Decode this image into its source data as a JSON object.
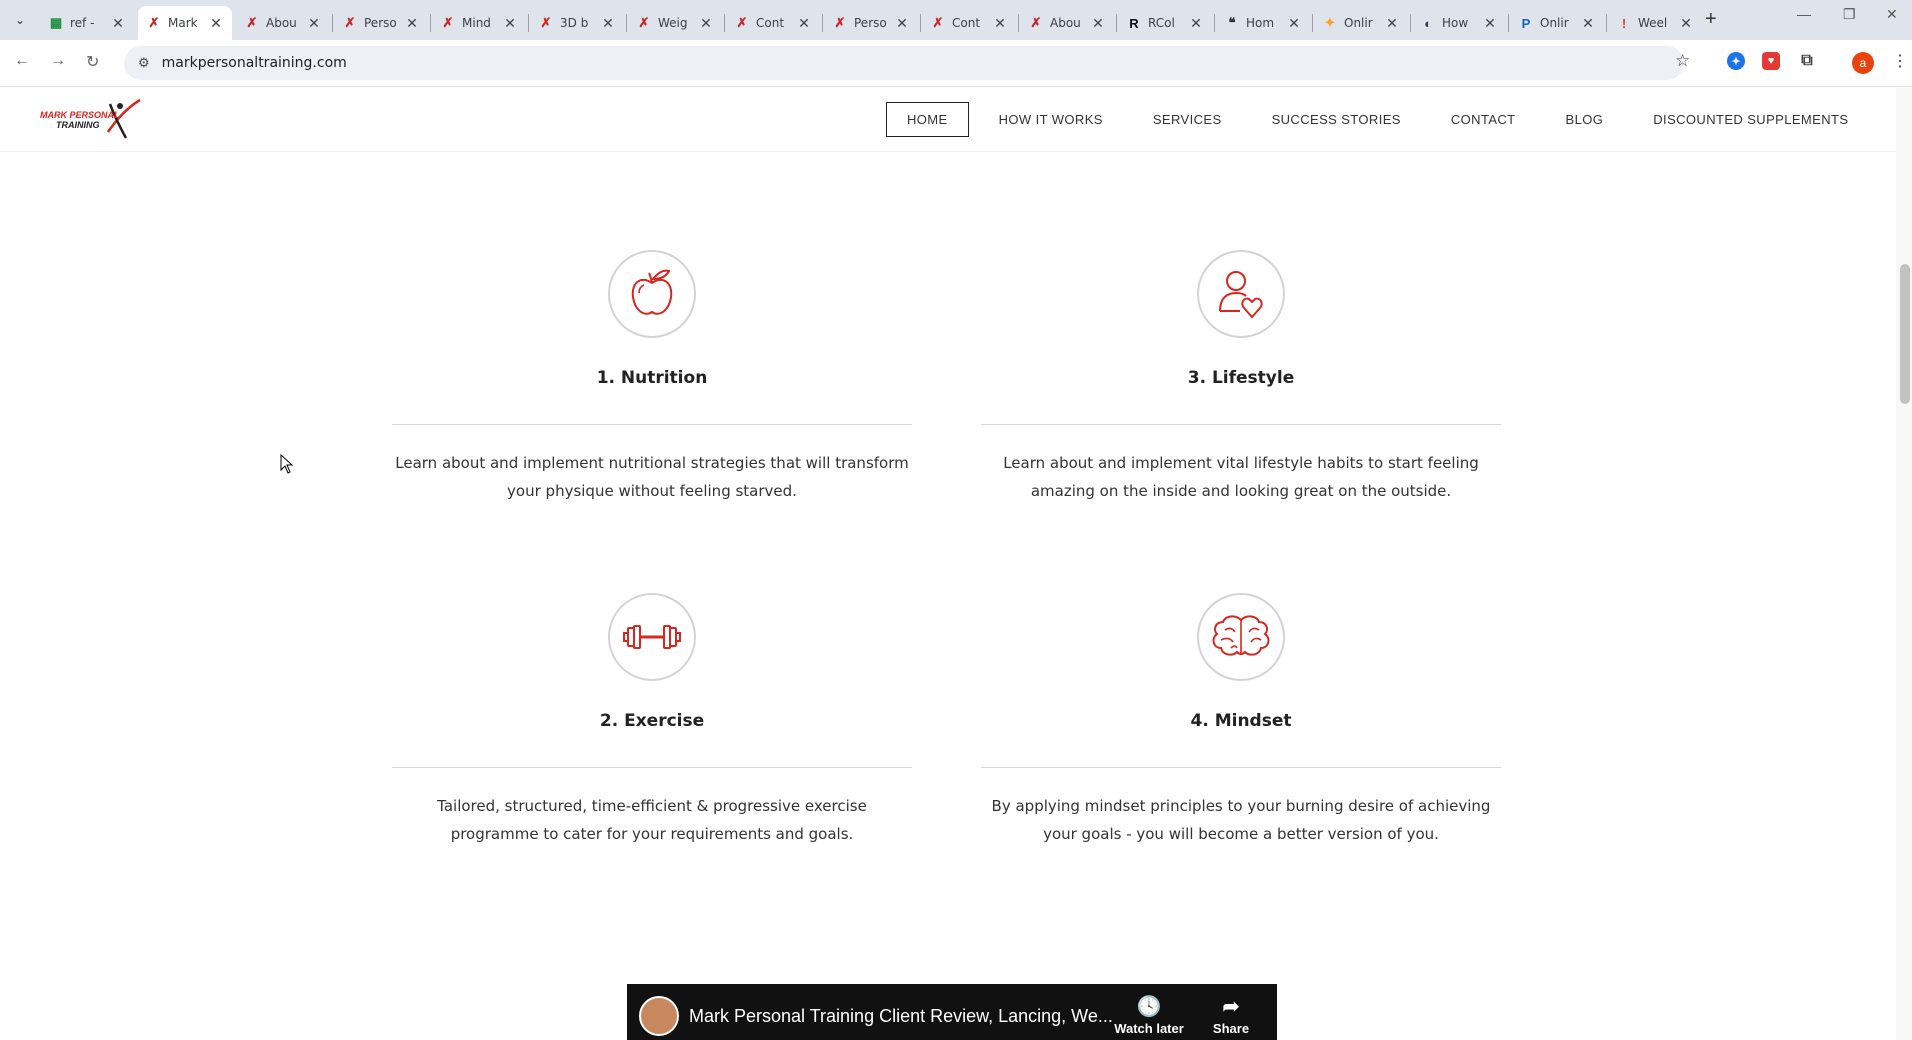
{
  "browser": {
    "tabs": [
      {
        "title": "ref -",
        "favicon": "sheets-icon",
        "color": "#1e8e3e",
        "active": false
      },
      {
        "title": "Mark",
        "favicon": "mpt-icon",
        "color": "#c62828",
        "active": true
      },
      {
        "title": "Abou",
        "favicon": "mpt-icon",
        "color": "#c62828",
        "active": false
      },
      {
        "title": "Perso",
        "favicon": "mpt-icon",
        "color": "#c62828",
        "active": false
      },
      {
        "title": "Mind",
        "favicon": "mpt-icon",
        "color": "#c62828",
        "active": false
      },
      {
        "title": "3D b",
        "favicon": "mpt-icon",
        "color": "#c62828",
        "active": false
      },
      {
        "title": "Weig",
        "favicon": "mpt-icon",
        "color": "#c62828",
        "active": false
      },
      {
        "title": "Cont",
        "favicon": "mpt-icon",
        "color": "#c62828",
        "active": false
      },
      {
        "title": "Perso",
        "favicon": "mpt-icon",
        "color": "#c62828",
        "active": false
      },
      {
        "title": "Cont",
        "favicon": "mpt-icon",
        "color": "#c62828",
        "active": false
      },
      {
        "title": "Abou",
        "favicon": "mpt-icon",
        "color": "#c62828",
        "active": false
      },
      {
        "title": "RCol",
        "favicon": "rc-icon",
        "color": "#111111",
        "active": false
      },
      {
        "title": "Hom",
        "favicon": "quote-icon",
        "color": "#333333",
        "active": false
      },
      {
        "title": "Onlir",
        "favicon": "figure-icon",
        "color": "#f5a623",
        "active": false
      },
      {
        "title": "How",
        "favicon": "globe-icon",
        "color": "#2c3e50",
        "active": false
      },
      {
        "title": "Onlir",
        "favicon": "p-icon",
        "color": "#1565c0",
        "active": false
      },
      {
        "title": "Weel",
        "favicon": "pin-icon",
        "color": "#e53935",
        "active": false
      }
    ],
    "url": "markpersonaltraining.com",
    "profile_initial": "a"
  },
  "site": {
    "logo_line1": "MARK PERSONAL",
    "logo_line2": "TRAINING",
    "nav": [
      "HOME",
      "HOW IT WORKS",
      "SERVICES",
      "SUCCESS STORIES",
      "CONTACT",
      "BLOG",
      "DISCOUNTED SUPPLEMENTS"
    ],
    "active_nav": "HOME",
    "accent_color": "#d8251d"
  },
  "features": [
    {
      "title": "1. Nutrition",
      "text": "Learn about and implement nutritional strategies that will transform your physique without feeling starved.",
      "icon": "apple-icon"
    },
    {
      "title": "3. Lifestyle",
      "text": "Learn about and implement vital lifestyle habits to start feeling amazing on the inside and looking great on the outside.",
      "icon": "person-heart-icon"
    },
    {
      "title": "2. Exercise",
      "text": "Tailored, structured, time-efficient & progressive exercise programme to cater for your requirements and goals.",
      "icon": "dumbbell-icon"
    },
    {
      "title": "4. Mindset",
      "text": "By applying mindset principles to your burning desire of achieving your goals - you will become a better version of you.",
      "icon": "brain-icon"
    }
  ],
  "video": {
    "title": "Mark Personal Training Client Review, Lancing, We...",
    "watch_later": "Watch later",
    "share": "Share"
  }
}
